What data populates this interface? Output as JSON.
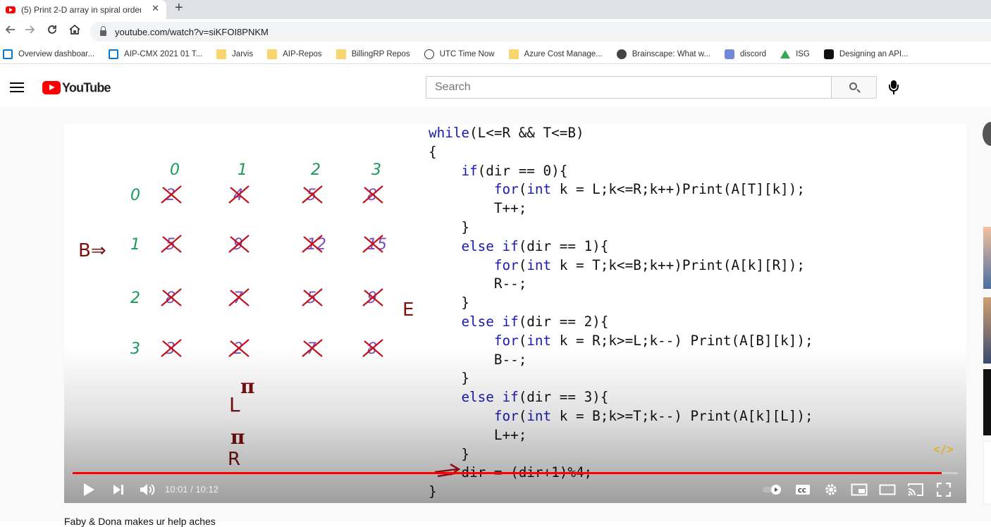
{
  "browser": {
    "tab_title": "(5) Print 2-D array in spiral order",
    "tab_close": "✕",
    "new_tab": "+",
    "url": "youtube.com/watch?v=siKFOI8PNKM",
    "bookmarks": [
      {
        "label": "Overview dashboar...",
        "icon": "azure-devops-icon"
      },
      {
        "label": "AIP-CMX 2021 01 T...",
        "icon": "azure-devops-icon"
      },
      {
        "label": "Jarvis",
        "icon": "folder-icon"
      },
      {
        "label": "AIP-Repos",
        "icon": "folder-icon"
      },
      {
        "label": "BillingRP Repos",
        "icon": "folder-icon"
      },
      {
        "label": "UTC Time Now",
        "icon": "clock-icon"
      },
      {
        "label": "Azure Cost Manage...",
        "icon": "folder-icon"
      },
      {
        "label": "Brainscape: What w...",
        "icon": "robot-icon"
      },
      {
        "label": "discord",
        "icon": "discord-icon"
      },
      {
        "label": "ISG",
        "icon": "drive-icon"
      },
      {
        "label": "Designing an API...",
        "icon": "zoom-icon"
      }
    ]
  },
  "youtube": {
    "logo_text": "YouTube",
    "search_placeholder": "Search"
  },
  "video": {
    "code_lines": [
      "while(L<=R && T<=B)",
      "{",
      "    if(dir == 0){",
      "        for(int k = L;k<=R;k++)Print(A[T][k]);",
      "        T++;",
      "    }",
      "    else if(dir == 1){",
      "        for(int k = T;k<=B;k++)Print(A[k][R]);",
      "        R--;",
      "    }",
      "    else if(dir == 2){",
      "        for(int k = R;k>=L;k--) Print(A[B][k]);",
      "        B--;",
      "    }",
      "    else if(dir == 3){",
      "        for(int k = B;k>=T;k--) Print(A[k][L]);",
      "        L++;",
      "    }",
      "    dir = (dir+1)%4;",
      "}"
    ],
    "handwriting": {
      "col_indices": [
        "0",
        "1",
        "2",
        "3"
      ],
      "row_indices": [
        "0",
        "1",
        "2",
        "3"
      ],
      "cells": [
        [
          "2",
          "4",
          "5",
          "8"
        ],
        [
          "5",
          "9",
          "12",
          "15"
        ],
        [
          "8",
          "7",
          "5",
          "9"
        ],
        [
          "3",
          "2",
          "7",
          "8"
        ]
      ],
      "b_label": "B⇒",
      "e_label": "E",
      "l_label": "L",
      "r_label": "R",
      "pi_symbol": "π",
      "arrow": "⇒"
    },
    "time_current": "10:01",
    "time_separator": " / ",
    "time_total": "10:12",
    "progress_fraction": 0.982,
    "code_badge": "</>",
    "accent_color": "#ff0000",
    "ink_red": "#c0141e",
    "ink_dark_red": "#7a1010",
    "ink_green": "#1a9a5a",
    "ink_purple": "#7a4fc0"
  },
  "below_video": {
    "text": "Faby & Dona makes ur help aches"
  }
}
